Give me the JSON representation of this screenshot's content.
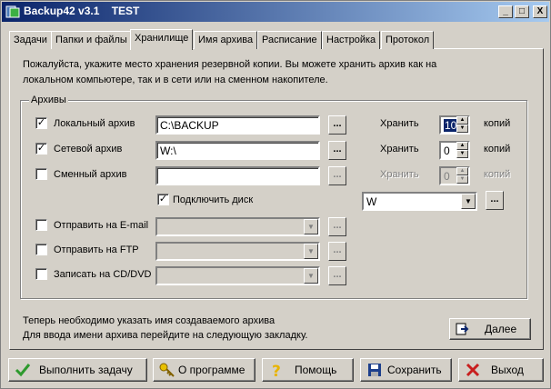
{
  "window": {
    "title": "Backup42 v3.1    TEST",
    "min_label": "_",
    "max_label": "□",
    "close_label": "X"
  },
  "tabs": [
    {
      "label": "Задачи"
    },
    {
      "label": "Папки и файлы"
    },
    {
      "label": "Хранилище"
    },
    {
      "label": "Имя архива"
    },
    {
      "label": "Расписание"
    },
    {
      "label": "Настройка"
    },
    {
      "label": "Протокол"
    }
  ],
  "active_tab": "Хранилище",
  "intro": {
    "line1": "Пожалуйста, укажите место хранения резервной копии. Вы можете хранить архив как на",
    "line2": "локальном компьютере, так и в сети или на сменном накопителе."
  },
  "archives": {
    "group_label": "Архивы",
    "local": {
      "label": "Локальный архив",
      "checked": true,
      "path": "C:\\BACKUP",
      "keep_label": "Хранить",
      "keep_value": "10",
      "copies_label": "копий"
    },
    "network": {
      "label": "Сетевой архив",
      "checked": true,
      "path": "W:\\",
      "keep_label": "Хранить",
      "keep_value": "0",
      "copies_label": "копий"
    },
    "removable": {
      "label": "Сменный архив",
      "checked": false,
      "path": "",
      "keep_label": "Хранить",
      "keep_value": "0",
      "copies_label": "копий"
    },
    "connect_disk": {
      "label": "Подключить диск",
      "checked": true,
      "drive": "W"
    },
    "email": {
      "label": "Отправить на E-mail",
      "checked": false,
      "value": ""
    },
    "ftp": {
      "label": "Отправить на FTP",
      "checked": false,
      "value": ""
    },
    "cd": {
      "label": "Записать на CD/DVD",
      "checked": false,
      "value": ""
    },
    "browse_label": "..."
  },
  "footnote": {
    "line1": "Теперь необходимо указать имя создаваемого архива",
    "line2": "Для ввода имени архива перейдите на следующую закладку."
  },
  "buttons": {
    "next": "Далее",
    "run": "Выполнить задачу",
    "about": "О программе",
    "help": "Помощь",
    "save": "Сохранить",
    "exit": "Выход"
  },
  "icons": {
    "app": "backup-app-icon",
    "next": "next-page-icon",
    "run": "green-check-icon",
    "about": "key-icon",
    "help": "question-mark-icon",
    "save": "floppy-disk-icon",
    "exit": "red-x-icon"
  },
  "colors": {
    "titlebar_start": "#0a246a",
    "titlebar_end": "#a6caf0",
    "face": "#d4d0c8",
    "run_check": "#2e9a2e",
    "exit_x": "#c81e1e",
    "help_q": "#e8b400"
  }
}
